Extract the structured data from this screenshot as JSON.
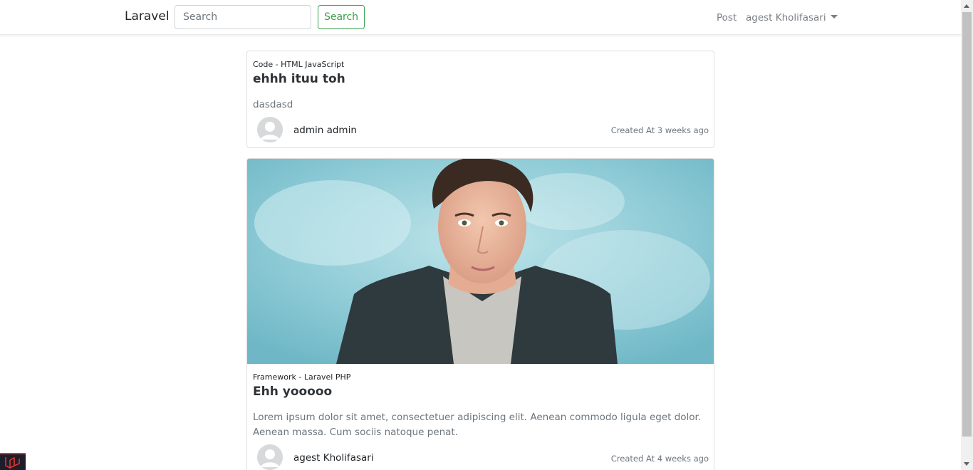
{
  "navbar": {
    "brand": "Laravel",
    "search_placeholder": "Search",
    "search_button": "Search",
    "post_link": "Post",
    "user_name": "agest Kholifasari"
  },
  "posts": [
    {
      "category": "Code - HTML JavaScript",
      "title": "ehhh ituu toh",
      "excerpt": "dasdasd",
      "author": "admin admin",
      "created": "Created At 3 weeks ago",
      "has_image": false
    },
    {
      "category": "Framework - Laravel PHP",
      "title": "Ehh yooooo",
      "excerpt": "Lorem ipsum dolor sit amet, consectetuer adipiscing elit. Aenean commodo ligula eget dolor. Aenean massa. Cum sociis natoque penat.",
      "author": "agest Kholifasari",
      "created": "Created At 4 weeks ago",
      "has_image": true
    }
  ],
  "colors": {
    "accent_green": "#38a04c",
    "image_background": "#9fd0dc",
    "debug_red": "#e3342f"
  },
  "icons": [
    "caret-down-icon",
    "avatar-placeholder-icon",
    "laravel-debugbar-icon"
  ]
}
